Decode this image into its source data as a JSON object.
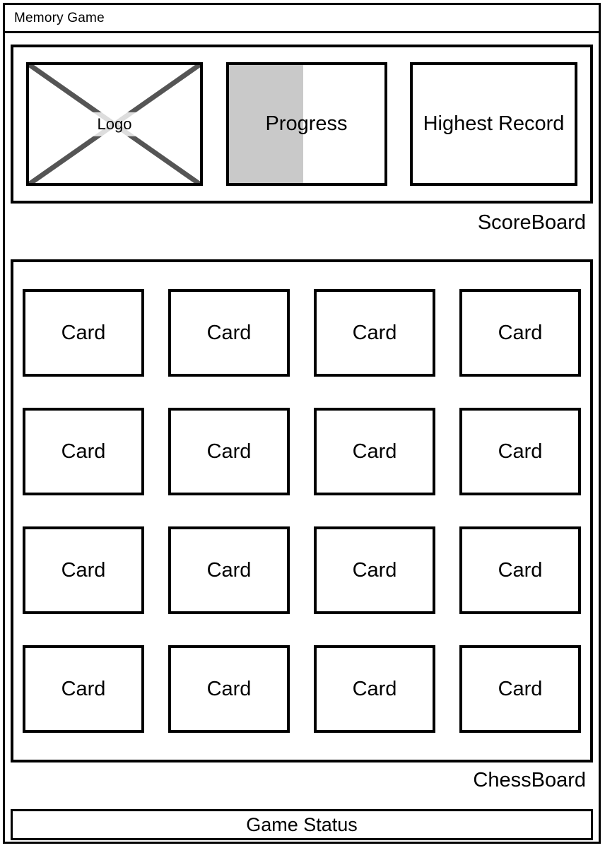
{
  "window": {
    "title": "Memory Game"
  },
  "scoreboard": {
    "caption": "ScoreBoard",
    "logo": {
      "label": "Logo",
      "placeholder_icon": "image-placeholder-x-icon"
    },
    "progress": {
      "label": "Progress",
      "fill_percent": 48,
      "fill_color": "#c9c9c9"
    },
    "record": {
      "label": "Highest Record"
    }
  },
  "chessboard": {
    "caption": "ChessBoard",
    "columns": 4,
    "rows": 4,
    "cards": [
      {
        "label": "Card"
      },
      {
        "label": "Card"
      },
      {
        "label": "Card"
      },
      {
        "label": "Card"
      },
      {
        "label": "Card"
      },
      {
        "label": "Card"
      },
      {
        "label": "Card"
      },
      {
        "label": "Card"
      },
      {
        "label": "Card"
      },
      {
        "label": "Card"
      },
      {
        "label": "Card"
      },
      {
        "label": "Card"
      },
      {
        "label": "Card"
      },
      {
        "label": "Card"
      },
      {
        "label": "Card"
      },
      {
        "label": "Card"
      }
    ]
  },
  "footer": {
    "status_label": "Game Status"
  },
  "colors": {
    "stroke": "#000000",
    "background": "#ffffff",
    "progress_fill": "#c9c9c9",
    "placeholder_line": "#555555"
  }
}
